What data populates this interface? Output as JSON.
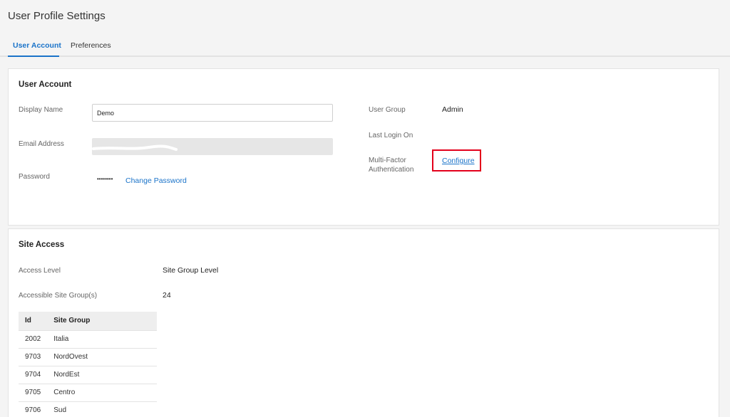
{
  "header": {
    "title": "User Profile Settings",
    "tabs": [
      {
        "label": "User Account",
        "active": true
      },
      {
        "label": "Preferences",
        "active": false
      }
    ]
  },
  "user_account": {
    "section_title": "User Account",
    "display_name_label": "Display Name",
    "display_name_value": "Demo",
    "email_label": "Email Address",
    "email_value": "",
    "password_label": "Password",
    "password_mask": "••••••••",
    "change_password_link": "Change Password",
    "user_group_label": "User Group",
    "user_group_value": "Admin",
    "last_login_label": "Last Login On",
    "last_login_value": "",
    "mfa_label": "Multi-Factor Authentication",
    "mfa_link": "Configure"
  },
  "site_access": {
    "section_title": "Site Access",
    "access_level_label": "Access Level",
    "access_level_value": "Site Group Level",
    "accessible_groups_label": "Accessible Site Group(s)",
    "accessible_groups_value": "24",
    "table": {
      "headers": [
        "Id",
        "Site Group"
      ],
      "rows": [
        {
          "id": "2002",
          "group": "Italia"
        },
        {
          "id": "9703",
          "group": "NordOvest"
        },
        {
          "id": "9704",
          "group": "NordEst"
        },
        {
          "id": "9705",
          "group": "Centro"
        },
        {
          "id": "9706",
          "group": "Sud"
        }
      ]
    }
  },
  "colors": {
    "accent": "#1a73c9",
    "highlight_box": "#e3001b"
  }
}
